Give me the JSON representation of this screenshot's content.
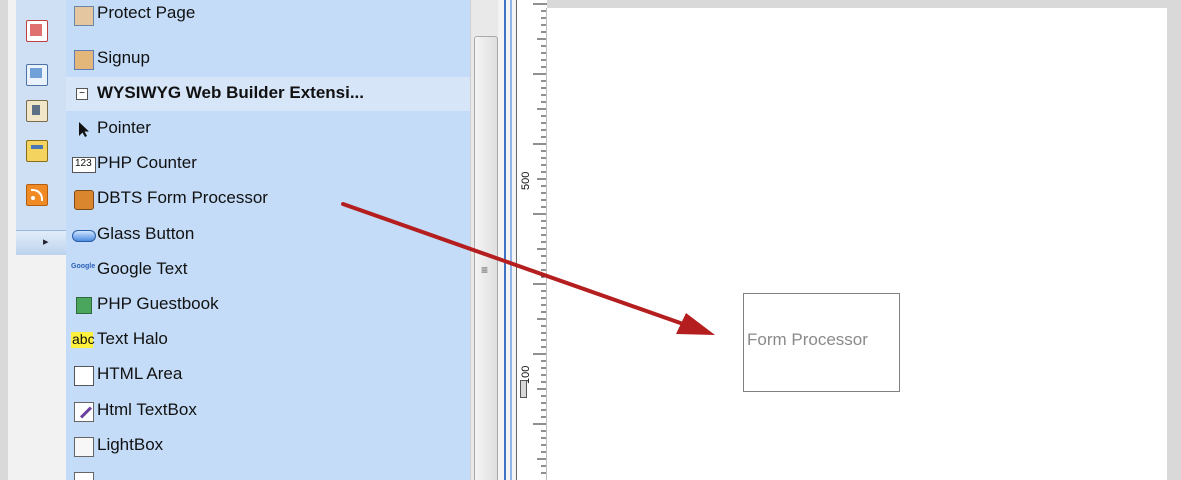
{
  "toolbox": {
    "items": [
      {
        "label": "Protect Page",
        "icon": "protect-page-icon",
        "type": "item"
      },
      {
        "label": "Signup",
        "icon": "signup-icon",
        "type": "item"
      },
      {
        "label": "WYSIWYG Web Builder Extensi...",
        "icon": "collapse-icon",
        "type": "group"
      },
      {
        "label": "Pointer",
        "icon": "pointer-icon",
        "type": "item"
      },
      {
        "label": "PHP Counter",
        "icon": "counter-icon",
        "type": "item"
      },
      {
        "label": "DBTS Form Processor",
        "icon": "form-processor-icon",
        "type": "item"
      },
      {
        "label": "Glass Button",
        "icon": "glass-button-icon",
        "type": "item"
      },
      {
        "label": "Google Text",
        "icon": "google-icon",
        "type": "item"
      },
      {
        "label": "PHP Guestbook",
        "icon": "guestbook-icon",
        "type": "item"
      },
      {
        "label": "Text Halo",
        "icon": "text-halo-icon",
        "type": "item"
      },
      {
        "label": "HTML Area",
        "icon": "html-area-icon",
        "type": "item"
      },
      {
        "label": "Html TextBox",
        "icon": "html-textbox-icon",
        "type": "item"
      },
      {
        "label": "LightBox",
        "icon": "lightbox-icon",
        "type": "item"
      }
    ],
    "icon_texts": {
      "counter": "123",
      "google": "Google",
      "halo": "abc"
    }
  },
  "sidebar": {
    "icons": [
      "image-icon",
      "layers-icon",
      "cursor-image-icon",
      "edit-icon",
      "rss-icon"
    ],
    "expander": "▸"
  },
  "ruler": {
    "label_upper": "500",
    "label_lower": "100"
  },
  "canvas": {
    "widget_label": "Form Processor"
  },
  "colors": {
    "arrow": "#b51e1e",
    "panel": "#c4dcf7",
    "accent": "#3c73c5"
  }
}
